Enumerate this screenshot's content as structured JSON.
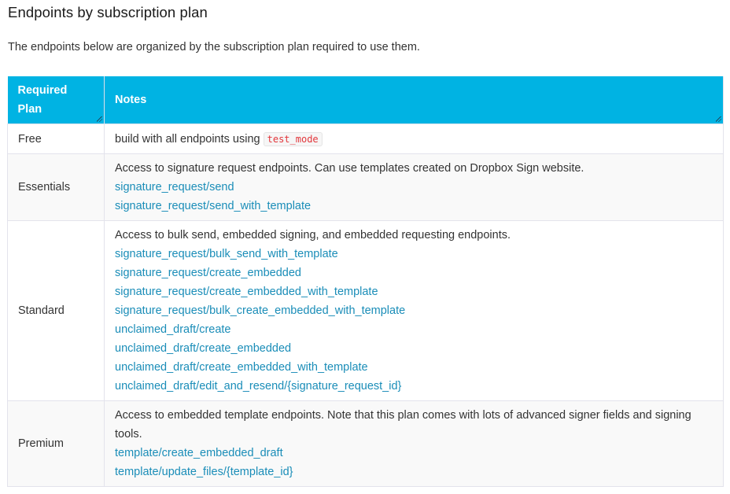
{
  "section": {
    "title": "Endpoints by subscription plan",
    "intro": "The endpoints below are organized by the subscription plan required to use them."
  },
  "table": {
    "headers": {
      "plan": "Required Plan",
      "notes": "Notes"
    },
    "rows": [
      {
        "plan": "Free",
        "note": "build with all endpoints using",
        "code": "test_mode",
        "links": []
      },
      {
        "plan": "Essentials",
        "note": "Access to signature request endpoints. Can use templates created on Dropbox Sign website.",
        "links": [
          "signature_request/send",
          "signature_request/send_with_template"
        ]
      },
      {
        "plan": "Standard",
        "note": "Access to bulk send, embedded signing, and embedded requesting endpoints.",
        "links": [
          "signature_request/bulk_send_with_template",
          "signature_request/create_embedded",
          "signature_request/create_embedded_with_template",
          "signature_request/bulk_create_embedded_with_template",
          "unclaimed_draft/create",
          "unclaimed_draft/create_embedded",
          "unclaimed_draft/create_embedded_with_template",
          "unclaimed_draft/edit_and_resend/{signature_request_id}"
        ]
      },
      {
        "plan": "Premium",
        "note": "Access to embedded template endpoints. Note that this plan comes with lots of advanced signer fields and signing tools.",
        "links": [
          "template/create_embedded_draft",
          "template/update_files/{template_id}"
        ]
      }
    ]
  },
  "colors": {
    "header_bg": "#00b3e3",
    "link": "#1a8db8",
    "code_text": "#e2363b"
  }
}
